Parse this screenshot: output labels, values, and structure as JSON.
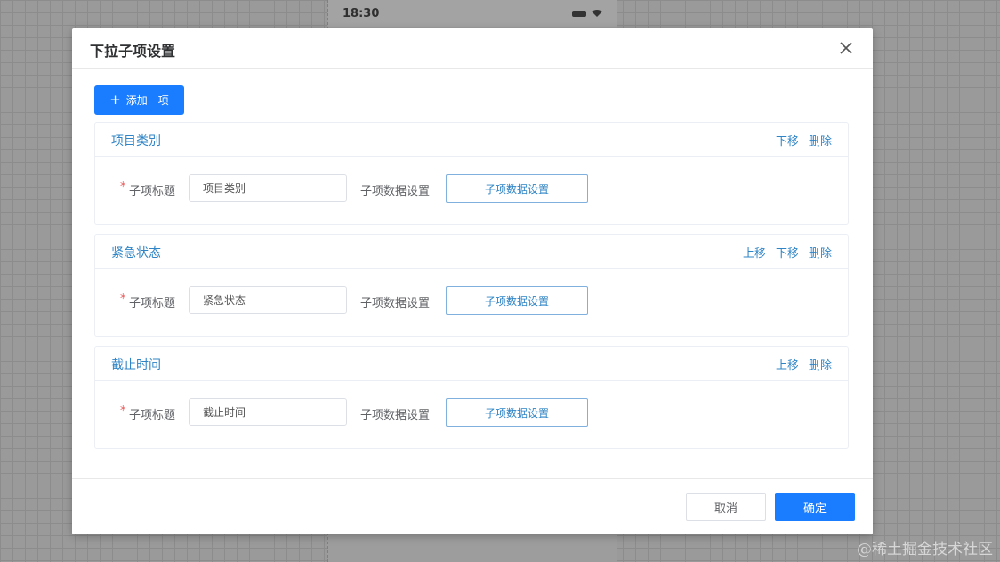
{
  "phone": {
    "time": "18:30"
  },
  "modal": {
    "title": "下拉子项设置",
    "add_button": "添加一项",
    "items": [
      {
        "title": "项目类别",
        "actions": [
          "下移",
          "删除"
        ],
        "field_label": "子项标题",
        "field_value": "项目类别",
        "data_label": "子项数据设置",
        "data_button": "子项数据设置"
      },
      {
        "title": "紧急状态",
        "actions": [
          "上移",
          "下移",
          "删除"
        ],
        "field_label": "子项标题",
        "field_value": "紧急状态",
        "data_label": "子项数据设置",
        "data_button": "子项数据设置"
      },
      {
        "title": "截止时间",
        "actions": [
          "上移",
          "删除"
        ],
        "field_label": "子项标题",
        "field_value": "截止时间",
        "data_label": "子项数据设置",
        "data_button": "子项数据设置"
      }
    ],
    "cancel_button": "取消",
    "ok_button": "确定"
  },
  "watermark": "@稀土掘金技术社区",
  "colors": {
    "primary": "#1a7cff",
    "link": "#2f84c6",
    "required": "#e85a5a"
  }
}
